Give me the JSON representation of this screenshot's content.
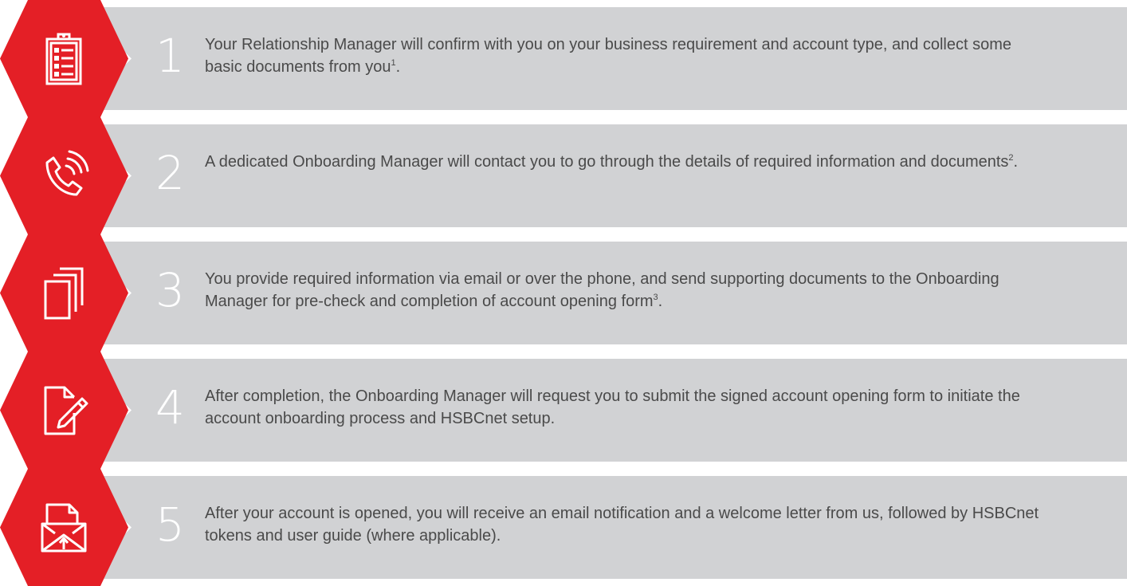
{
  "brand": {
    "accent_color": "#e41f26",
    "bar_color": "#d1d2d4"
  },
  "steps": [
    {
      "number": "1",
      "icon": "clipboard-checklist-icon",
      "text": "Your Relationship Manager will confirm with you on your business requirement and account type, and collect some basic documents from you",
      "footnote": "1",
      "end": "."
    },
    {
      "number": "2",
      "icon": "phone-call-icon",
      "text": "A dedicated Onboarding Manager will contact you to go through the details of required information and documents",
      "footnote": "2",
      "end": "."
    },
    {
      "number": "3",
      "icon": "documents-stack-icon",
      "text": "You provide required information via email or over the phone, and send supporting documents to the Onboarding Manager for pre-check and completion of account opening form",
      "footnote": "3",
      "end": "."
    },
    {
      "number": "4",
      "icon": "document-pen-icon",
      "text": "After completion, the Onboarding Manager will request you to submit the signed account opening form to initiate the account onboarding process and HSBCnet setup.",
      "footnote": "",
      "end": ""
    },
    {
      "number": "5",
      "icon": "mail-document-icon",
      "text": "After your account is opened, you will receive an email notification and a welcome letter from us, followed by HSBCnet tokens and user guide (where applicable).",
      "footnote": "",
      "end": ""
    }
  ]
}
